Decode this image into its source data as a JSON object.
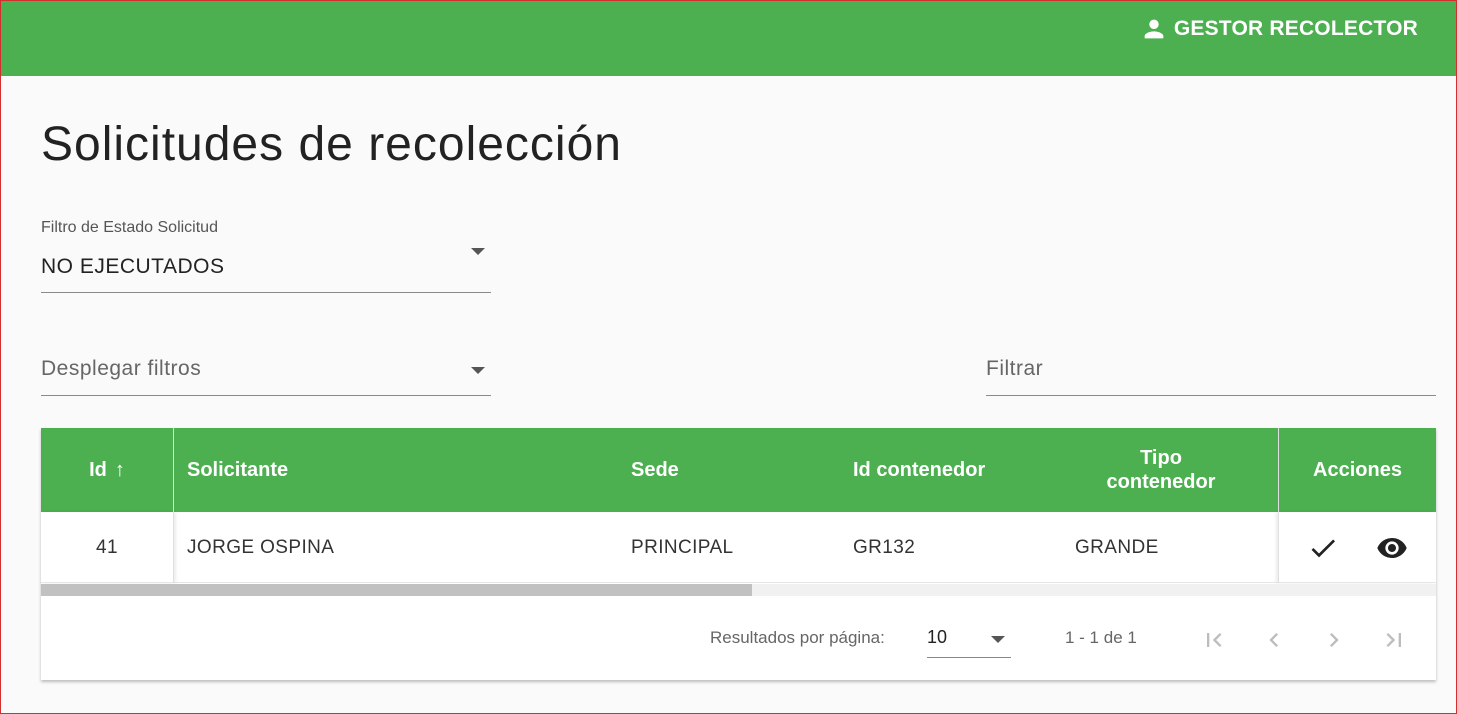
{
  "header": {
    "user_label": "GESTOR RECOLECTOR",
    "user_icon": "account-icon",
    "bar_color": "#4caf50"
  },
  "page": {
    "title": "Solicitudes de recolección"
  },
  "filters": {
    "state_filter": {
      "label": "Filtro de Estado Solicitud",
      "value": "NO EJECUTADOS"
    },
    "more_filters": {
      "placeholder": "Desplegar filtros"
    },
    "text_filter": {
      "placeholder": "Filtrar"
    }
  },
  "table": {
    "columns": {
      "id": "Id",
      "solicitante": "Solicitante",
      "sede": "Sede",
      "id_contenedor": "Id contenedor",
      "tipo_contenedor_1": "Tipo",
      "tipo_contenedor_2": "contenedor",
      "acciones": "Acciones"
    },
    "sort_indicator": "↑",
    "rows": [
      {
        "id": "41",
        "solicitante": "JORGE OSPINA",
        "sede": "PRINCIPAL",
        "id_contenedor": "GR132",
        "tipo_contenedor": "GRANDE",
        "actions": [
          "check-icon",
          "eye-icon"
        ]
      }
    ],
    "scroll_fraction": 0.51
  },
  "paginator": {
    "per_page_label": "Resultados por página:",
    "per_page_value": "10",
    "range_label": "1 - 1 de 1"
  }
}
